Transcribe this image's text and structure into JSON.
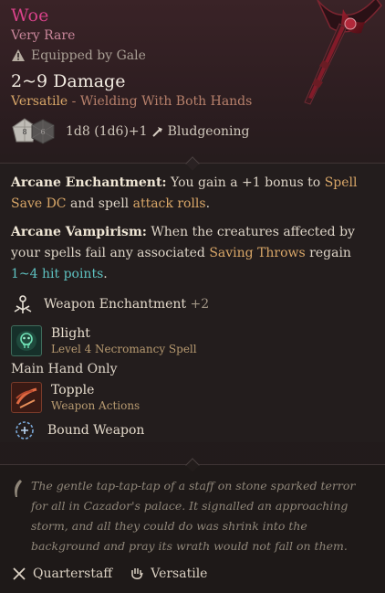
{
  "item": {
    "name": "Woe",
    "rarity": "Very Rare",
    "equipped": "Equipped by Gale",
    "damage": "2~9 Damage",
    "versatile_label": "Versatile",
    "versatile_detail": " - Wielding With Both Hands",
    "dice": {
      "die1_label": "8",
      "die2_label": "6"
    },
    "dice_formula": "1d8 (1d6)+1",
    "damage_type": "Bludgeoning"
  },
  "body": {
    "arcane_enchantment": {
      "title": "Arcane Enchantment:",
      "t1": " You gain a +1 bonus to ",
      "h1": "Spell Save DC",
      "t2": " and spell ",
      "h2": "attack rolls",
      "t3": "."
    },
    "arcane_vampirism": {
      "title": "Arcane Vampirism:",
      "t1": " When the creatures affected by your spells fail any associated ",
      "h1": "Saving Throws",
      "t2": " regain ",
      "h2": "1~4 hit points",
      "t3": "."
    },
    "weapon_enchantment": {
      "label": "Weapon Enchantment",
      "value": "+2"
    },
    "spell": {
      "name": "Blight",
      "sub": "Level 4 Necromancy Spell"
    },
    "main_hand_only": "Main Hand Only",
    "action": {
      "name": "Topple",
      "sub": "Weapon Actions"
    },
    "bound_weapon": "Bound Weapon"
  },
  "footer": {
    "lore": "The gentle tap-tap-tap of a staff on stone sparked terror for all in Cazador's palace. It signalled an approaching storm, and all they could do was shrink into the background and pray its wrath would not fall on them.",
    "tags": [
      "Quarterstaff",
      "Versatile"
    ]
  },
  "colors": {
    "name": "#d9428a",
    "rarity": "#c8869a",
    "amber": "#d9a768",
    "teal": "#5ec1c0"
  },
  "icons": [
    "warning-icon",
    "staff-weapon-art",
    "d8-die-icon",
    "d6-die-icon",
    "bludgeoning-icon",
    "weapon-enchantment-icon",
    "blight-spell-icon",
    "topple-action-icon",
    "bound-weapon-icon",
    "lore-quill-icon",
    "quarterstaff-icon",
    "versatile-hand-icon"
  ]
}
